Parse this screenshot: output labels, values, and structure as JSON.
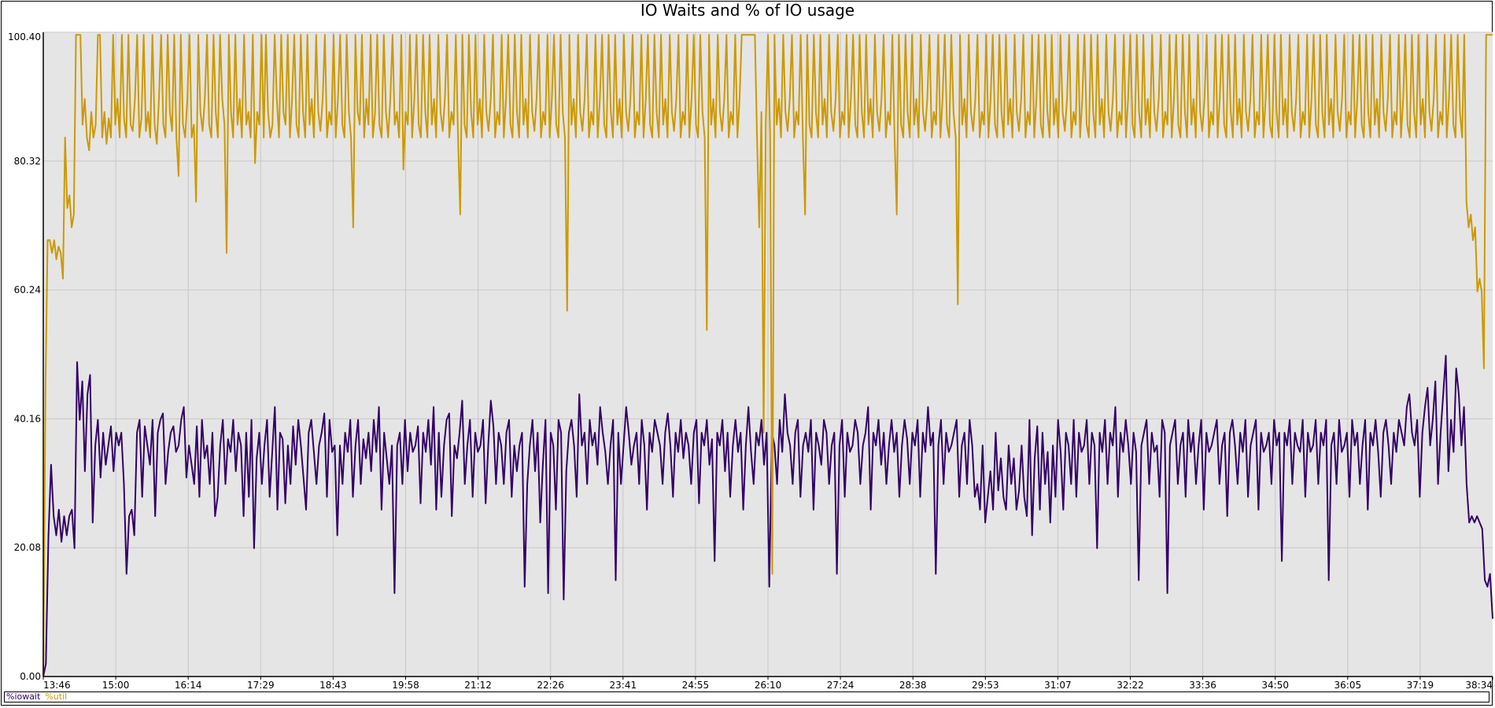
{
  "chart_data": {
    "type": "line",
    "title": "IO Waits and % of IO usage",
    "xlabel": "",
    "ylabel": "",
    "ylim": [
      0,
      100.4
    ],
    "yticks": [
      "0.00",
      "20.08",
      "40.16",
      "60.24",
      "80.32",
      "100.40"
    ],
    "xticks": [
      "13:46",
      "15:00",
      "16:14",
      "17:29",
      "18:43",
      "19:58",
      "21:12",
      "22:26",
      "23:41",
      "24:55",
      "26:10",
      "27:24",
      "28:38",
      "29:53",
      "31:07",
      "32:22",
      "33:36",
      "34:50",
      "36:05",
      "37:19",
      "38:34"
    ],
    "grid": true,
    "legend_position": "bottom-left",
    "background": "#e5e5e5",
    "series": [
      {
        "name": "%iowait",
        "color": "#330066",
        "values": [
          0,
          2,
          22,
          33,
          25,
          22,
          26,
          21,
          25,
          22,
          25,
          26,
          20,
          49,
          40,
          46,
          32,
          44,
          47,
          24,
          36,
          40,
          31,
          38,
          33,
          36,
          39,
          32,
          38,
          36,
          38,
          30,
          16,
          25,
          26,
          22,
          38,
          40,
          28,
          39,
          36,
          33,
          40,
          25,
          38,
          40,
          41,
          30,
          35,
          38,
          39,
          35,
          36,
          40,
          42,
          31,
          36,
          33,
          30,
          39,
          28,
          40,
          34,
          36,
          30,
          38,
          25,
          28,
          36,
          40,
          30,
          37,
          35,
          40,
          32,
          38,
          36,
          25,
          38,
          28,
          40,
          20,
          34,
          38,
          30,
          36,
          40,
          28,
          35,
          42,
          26,
          38,
          37,
          27,
          36,
          30,
          39,
          33,
          40,
          36,
          31,
          26,
          38,
          40,
          35,
          30,
          36,
          38,
          41,
          28,
          40,
          35,
          36,
          22,
          36,
          30,
          38,
          35,
          40,
          28,
          36,
          40,
          30,
          37,
          34,
          38,
          32,
          40,
          35,
          42,
          26,
          38,
          34,
          30,
          36,
          13,
          36,
          38,
          30,
          40,
          32,
          38,
          35,
          36,
          39,
          27,
          38,
          35,
          40,
          33,
          42,
          26,
          38,
          28,
          36,
          40,
          41,
          25,
          36,
          34,
          38,
          43,
          30,
          36,
          40,
          28,
          38,
          35,
          36,
          40,
          27,
          36,
          43,
          39,
          30,
          38,
          36,
          30,
          38,
          40,
          28,
          36,
          32,
          36,
          38,
          14,
          30,
          36,
          40,
          32,
          38,
          24,
          33,
          40,
          13,
          38,
          36,
          26,
          40,
          38,
          12,
          32,
          38,
          40,
          36,
          28,
          44,
          36,
          38,
          30,
          40,
          36,
          38,
          33,
          42,
          38,
          35,
          30,
          36,
          40,
          15,
          38,
          30,
          36,
          42,
          38,
          33,
          36,
          38,
          30,
          40,
          36,
          26,
          38,
          35,
          40,
          38,
          36,
          30,
          38,
          41,
          36,
          28,
          38,
          35,
          40,
          34,
          38,
          36,
          30,
          38,
          40,
          27,
          38,
          36,
          40,
          33,
          37,
          18,
          38,
          36,
          40,
          32,
          38,
          28,
          36,
          40,
          35,
          38,
          26,
          36,
          42,
          35,
          30,
          38,
          36,
          40,
          33,
          38,
          14,
          38,
          36,
          30,
          40,
          35,
          44,
          38,
          36,
          30,
          38,
          40,
          28,
          36,
          38,
          35,
          40,
          26,
          38,
          36,
          33,
          40,
          38,
          30,
          36,
          38,
          16,
          36,
          40,
          28,
          38,
          35,
          36,
          40,
          38,
          30,
          36,
          38,
          42,
          26,
          38,
          36,
          40,
          33,
          38,
          30,
          36,
          40,
          35,
          38,
          28,
          36,
          40,
          37,
          30,
          38,
          36,
          40,
          28,
          38,
          35,
          42,
          36,
          38,
          16,
          36,
          40,
          30,
          38,
          35,
          36,
          38,
          40,
          28,
          36,
          38,
          30,
          40,
          36,
          28,
          30,
          26,
          36,
          24,
          28,
          32,
          26,
          38,
          29,
          34,
          28,
          26,
          36,
          30,
          34,
          26,
          29,
          36,
          28,
          25,
          40,
          22,
          34,
          39,
          26,
          38,
          30,
          35,
          24,
          36,
          28,
          40,
          35,
          26,
          38,
          36,
          30,
          40,
          28,
          38,
          35,
          36,
          40,
          30,
          38,
          36,
          20,
          38,
          35,
          40,
          30,
          38,
          36,
          42,
          28,
          38,
          35,
          40,
          36,
          30,
          38,
          35,
          15,
          36,
          38,
          40,
          30,
          38,
          35,
          36,
          28,
          40,
          38,
          13,
          36,
          38,
          40,
          30,
          36,
          38,
          28,
          40,
          35,
          38,
          30,
          36,
          40,
          26,
          38,
          35,
          36,
          38,
          40,
          30,
          36,
          38,
          25,
          38,
          40,
          36,
          30,
          38,
          35,
          40,
          28,
          36,
          38,
          40,
          26,
          38,
          35,
          36,
          38,
          30,
          40,
          36,
          38,
          18,
          38,
          36,
          40,
          30,
          38,
          36,
          35,
          40,
          28,
          38,
          35,
          36,
          40,
          30,
          38,
          36,
          40,
          15,
          36,
          38,
          30,
          40,
          35,
          36,
          38,
          28,
          40,
          36,
          38,
          30,
          36,
          40,
          26,
          38,
          36,
          40,
          35,
          28,
          38,
          40,
          36,
          30,
          38,
          35,
          40,
          38,
          36,
          42,
          44,
          38,
          36,
          40,
          28,
          38,
          42,
          45,
          36,
          40,
          46,
          30,
          38,
          44,
          50,
          32,
          40,
          35,
          48,
          44,
          36,
          42,
          30,
          24,
          25,
          24,
          25,
          24,
          23,
          15,
          14,
          16,
          9
        ]
      },
      {
        "name": "%util",
        "color": "#cc9900",
        "values": [
          0,
          45,
          68,
          68,
          66,
          68,
          65,
          67,
          66,
          62,
          84,
          73,
          75,
          70,
          72,
          100,
          100,
          100,
          86,
          90,
          84,
          82,
          88,
          84,
          86,
          100,
          100,
          84,
          88,
          83,
          87,
          84,
          100,
          86,
          90,
          84,
          100,
          87,
          84,
          100,
          86,
          85,
          90,
          100,
          84,
          87,
          100,
          85,
          88,
          84,
          100,
          86,
          83,
          90,
          100,
          86,
          84,
          100,
          88,
          85,
          100,
          84,
          78,
          100,
          86,
          84,
          90,
          100,
          84,
          86,
          74,
          100,
          88,
          85,
          90,
          100,
          86,
          84,
          100,
          88,
          84,
          100,
          90,
          86,
          66,
          100,
          88,
          84,
          100,
          86,
          90,
          84,
          100,
          86,
          88,
          84,
          100,
          80,
          88,
          86,
          100,
          84,
          100,
          88,
          84,
          86,
          100,
          90,
          84,
          100,
          88,
          86,
          100,
          84,
          90,
          100,
          86,
          84,
          100,
          88,
          84,
          100,
          86,
          90,
          84,
          100,
          88,
          85,
          90,
          100,
          84,
          88,
          86,
          100,
          84,
          90,
          100,
          86,
          84,
          100,
          88,
          84,
          70,
          100,
          88,
          86,
          100,
          84,
          90,
          86,
          100,
          84,
          88,
          100,
          86,
          84,
          100,
          88,
          84,
          90,
          100,
          86,
          88,
          84,
          100,
          79,
          88,
          86,
          100,
          84,
          90,
          100,
          86,
          84,
          100,
          88,
          84,
          100,
          86,
          90,
          84,
          100,
          88,
          85,
          90,
          100,
          84,
          88,
          86,
          100,
          84,
          72,
          100,
          86,
          84,
          100,
          88,
          84,
          100,
          86,
          90,
          84,
          100,
          88,
          85,
          90,
          100,
          84,
          88,
          86,
          100,
          84,
          90,
          100,
          86,
          84,
          100,
          88,
          84,
          100,
          86,
          90,
          84,
          100,
          88,
          85,
          90,
          100,
          84,
          88,
          86,
          100,
          84,
          90,
          100,
          86,
          84,
          100,
          88,
          84,
          57,
          100,
          86,
          90,
          84,
          100,
          88,
          85,
          90,
          100,
          84,
          88,
          86,
          100,
          84,
          90,
          100,
          86,
          84,
          100,
          88,
          84,
          100,
          86,
          90,
          84,
          100,
          88,
          85,
          90,
          100,
          84,
          88,
          86,
          100,
          84,
          90,
          100,
          86,
          84,
          100,
          88,
          84,
          100,
          86,
          90,
          84,
          100,
          88,
          85,
          90,
          100,
          84,
          88,
          86,
          100,
          84,
          90,
          100,
          86,
          84,
          100,
          88,
          84,
          54,
          100,
          86,
          90,
          84,
          100,
          88,
          85,
          90,
          100,
          84,
          88,
          86,
          100,
          84,
          90,
          100,
          100,
          100,
          100,
          100,
          100,
          100,
          84,
          70,
          88,
          38,
          86,
          100,
          84,
          16,
          100,
          86,
          90,
          84,
          100,
          88,
          85,
          90,
          100,
          84,
          88,
          86,
          100,
          84,
          72,
          100,
          86,
          84,
          100,
          88,
          84,
          100,
          86,
          90,
          84,
          100,
          88,
          85,
          90,
          100,
          84,
          88,
          86,
          100,
          84,
          90,
          100,
          86,
          84,
          100,
          88,
          84,
          100,
          86,
          90,
          84,
          100,
          88,
          85,
          90,
          100,
          84,
          88,
          86,
          100,
          84,
          72,
          100,
          86,
          84,
          100,
          88,
          84,
          100,
          86,
          90,
          84,
          100,
          88,
          85,
          90,
          100,
          84,
          88,
          86,
          100,
          84,
          90,
          100,
          86,
          84,
          100,
          88,
          84,
          58,
          100,
          86,
          90,
          84,
          100,
          88,
          85,
          90,
          100,
          84,
          88,
          86,
          100,
          84,
          90,
          100,
          86,
          84,
          100,
          88,
          84,
          100,
          86,
          90,
          84,
          100,
          88,
          85,
          90,
          100,
          84,
          88,
          86,
          100,
          84,
          90,
          100,
          86,
          84,
          100,
          88,
          84,
          100,
          86,
          90,
          84,
          100,
          88,
          85,
          90,
          100,
          84,
          88,
          86,
          100,
          84,
          90,
          100,
          86,
          84,
          100,
          88,
          84,
          100,
          86,
          90,
          84,
          100,
          88,
          85,
          90,
          100,
          84,
          88,
          86,
          100,
          84,
          90,
          100,
          86,
          84,
          100,
          88,
          84,
          100,
          86,
          90,
          84,
          100,
          88,
          85,
          90,
          100,
          84,
          88,
          86,
          100,
          84,
          90,
          100,
          86,
          84,
          100,
          88,
          84,
          100,
          86,
          90,
          84,
          100,
          88,
          85,
          90,
          100,
          84,
          88,
          86,
          100,
          84,
          90,
          100,
          86,
          84,
          100,
          88,
          84,
          100,
          86,
          90,
          84,
          100,
          88,
          85,
          90,
          100,
          84,
          88,
          86,
          100,
          84,
          90,
          100,
          86,
          84,
          100,
          88,
          84,
          100,
          86,
          90,
          84,
          100,
          88,
          85,
          90,
          100,
          84,
          88,
          86,
          100,
          84,
          90,
          100,
          86,
          84,
          100,
          88,
          84,
          100,
          86,
          90,
          84,
          100,
          88,
          85,
          90,
          100,
          84,
          88,
          86,
          100,
          84,
          90,
          100,
          86,
          84,
          100,
          88,
          84,
          100,
          86,
          90,
          84,
          100,
          88,
          85,
          90,
          100,
          84,
          88,
          86,
          100,
          84,
          90,
          100,
          86,
          84,
          100,
          88,
          84,
          100,
          86,
          90,
          84,
          100,
          88,
          85,
          90,
          100,
          84,
          88,
          86,
          100,
          84,
          90,
          100,
          86,
          84,
          100,
          88,
          84,
          100,
          74,
          70,
          72,
          68,
          70,
          60,
          62,
          60,
          48,
          100,
          100,
          100,
          100
        ]
      }
    ]
  }
}
